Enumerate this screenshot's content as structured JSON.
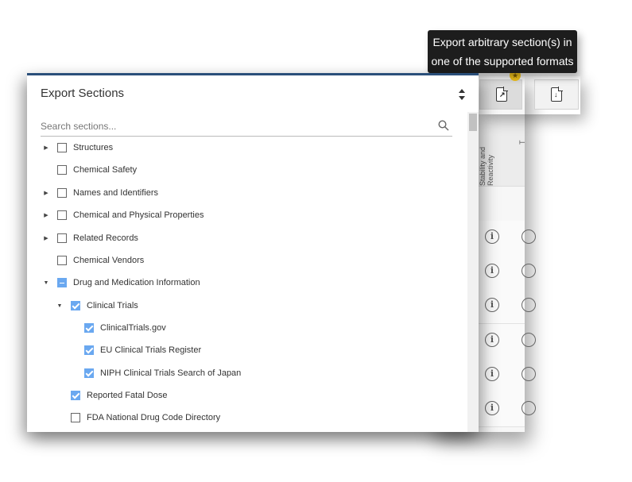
{
  "tooltip": {
    "line1": "Export arbitrary section(s) in",
    "line2": "one of the supported formats"
  },
  "background_table": {
    "column_header": "Stability and Reactivity",
    "row_icon": "info-icon",
    "row_count": 6
  },
  "toolbar": {
    "export_sections_icon": "document-export-icon",
    "download_icon": "document-download-icon",
    "badge_icon": "new-badge-icon"
  },
  "dialog": {
    "title": "Export Sections",
    "search_placeholder": "Search sections...",
    "items": [
      {
        "label": "Structures",
        "state": "unchecked",
        "caret": "collapsed"
      },
      {
        "label": "Chemical Safety",
        "state": "unchecked",
        "caret": "none"
      },
      {
        "label": "Names and Identifiers",
        "state": "unchecked",
        "caret": "collapsed"
      },
      {
        "label": "Chemical and Physical Properties",
        "state": "unchecked",
        "caret": "collapsed"
      },
      {
        "label": "Related Records",
        "state": "unchecked",
        "caret": "collapsed"
      },
      {
        "label": "Chemical Vendors",
        "state": "unchecked",
        "caret": "none"
      },
      {
        "label": "Drug and Medication Information",
        "state": "partial",
        "caret": "expanded"
      },
      {
        "label": "Clinical Trials",
        "state": "checked",
        "caret": "expanded"
      },
      {
        "label": "ClinicalTrials.gov",
        "state": "checked",
        "caret": "none"
      },
      {
        "label": "EU Clinical Trials Register",
        "state": "checked",
        "caret": "none"
      },
      {
        "label": "NIPH Clinical Trials Search of Japan",
        "state": "checked",
        "caret": "none"
      },
      {
        "label": "Reported Fatal Dose",
        "state": "checked",
        "caret": "none"
      },
      {
        "label": "FDA National Drug Code Directory",
        "state": "unchecked",
        "caret": "none"
      }
    ]
  },
  "colors": {
    "checkbox_checked": "#6aa8f0",
    "dialog_accent": "#2a4f7a",
    "tooltip_bg": "#1d1d1d",
    "badge": "#f2c21b"
  }
}
